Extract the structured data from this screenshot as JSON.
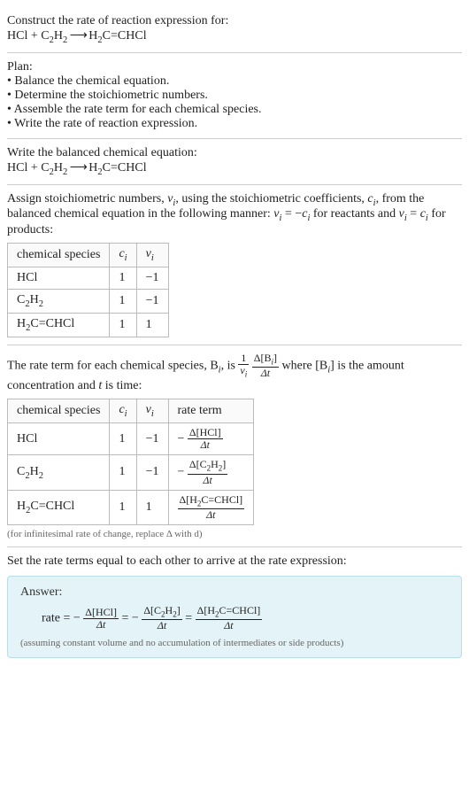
{
  "prompt": {
    "title": "Construct the rate of reaction expression for:",
    "equation_plain": "HCl + C2H2 ⟶ H2C=CHCl",
    "lhs1": "HCl",
    "plus": " + ",
    "lhs2_a": "C",
    "lhs2_b": "2",
    "lhs2_c": "H",
    "lhs2_d": "2",
    "arrow": " ⟶ ",
    "rhs_a": "H",
    "rhs_b": "2",
    "rhs_c": "C=CHCl"
  },
  "plan": {
    "heading": "Plan:",
    "b1": "• Balance the chemical equation.",
    "b2": "• Determine the stoichiometric numbers.",
    "b3": "• Assemble the rate term for each chemical species.",
    "b4": "• Write the rate of reaction expression."
  },
  "balanced": {
    "heading": "Write the balanced chemical equation:"
  },
  "assign": {
    "intro_a": "Assign stoichiometric numbers, ",
    "intro_b": "ν",
    "intro_c": "i",
    "intro_d": ", using the stoichiometric coefficients, ",
    "intro_e": "c",
    "intro_f": "i",
    "intro_g": ", from the balanced chemical equation in the following manner: ",
    "rel1a": "ν",
    "rel1b": "i",
    "rel1c": " = −",
    "rel1d": "c",
    "rel1e": "i",
    "intro_h": " for reactants and ",
    "rel2a": "ν",
    "rel2b": "i",
    "rel2c": " = ",
    "rel2d": "c",
    "rel2e": "i",
    "intro_i": " for products:",
    "col1": "chemical species",
    "col2a": "c",
    "col2b": "i",
    "col3a": "ν",
    "col3b": "i",
    "r1c1": "HCl",
    "r1c2": "1",
    "r1c3": "−1",
    "r2c2": "1",
    "r2c3": "−1",
    "r3c2": "1",
    "r3c3": "1"
  },
  "rate_term": {
    "intro_a": "The rate term for each chemical species, B",
    "intro_b": "i",
    "intro_c": ", is ",
    "one": "1",
    "nu": "ν",
    "nui": "i",
    "dB_l": "Δ[B",
    "dB_i": "i",
    "dB_r": "]",
    "dt": "Δt",
    "intro_d": " where [B",
    "intro_e": "i",
    "intro_f": "] is the amount concentration and ",
    "t": "t",
    "intro_g": " is time:",
    "col1": "chemical species",
    "col2a": "c",
    "col2b": "i",
    "col3a": "ν",
    "col3b": "i",
    "col4": "rate term",
    "r1c1": "HCl",
    "r1c2": "1",
    "r1c3": "−1",
    "r1_num": "Δ[HCl]",
    "r1_den": "Δt",
    "r1_sign": "− ",
    "r2c2": "1",
    "r2c3": "−1",
    "r2_num_a": "Δ[C",
    "r2_num_b": "2",
    "r2_num_c": "H",
    "r2_num_d": "2",
    "r2_num_e": "]",
    "r2_den": "Δt",
    "r2_sign": "− ",
    "r3c2": "1",
    "r3c3": "1",
    "r3_num_a": "Δ[H",
    "r3_num_b": "2",
    "r3_num_c": "C=CHCl]",
    "r3_den": "Δt",
    "note": "(for infinitesimal rate of change, replace Δ with d)"
  },
  "final": {
    "heading": "Set the rate terms equal to each other to arrive at the rate expression:",
    "answer_label": "Answer:",
    "rate": "rate = ",
    "minus": "− ",
    "f1_num": "Δ[HCl]",
    "f1_den": "Δt",
    "eq": " = ",
    "f2_num_a": "Δ[C",
    "f2_num_b": "2",
    "f2_num_c": "H",
    "f2_num_d": "2",
    "f2_num_e": "]",
    "f2_den": "Δt",
    "f3_num_a": "Δ[H",
    "f3_num_b": "2",
    "f3_num_c": "C=CHCl]",
    "f3_den": "Δt",
    "assumption": "(assuming constant volume and no accumulation of intermediates or side products)"
  },
  "chart_data": {
    "type": "table",
    "tables": [
      {
        "title": "Stoichiometric numbers",
        "columns": [
          "chemical species",
          "c_i",
          "ν_i"
        ],
        "rows": [
          [
            "HCl",
            1,
            -1
          ],
          [
            "C2H2",
            1,
            -1
          ],
          [
            "H2C=CHCl",
            1,
            1
          ]
        ]
      },
      {
        "title": "Rate terms",
        "columns": [
          "chemical species",
          "c_i",
          "ν_i",
          "rate term"
        ],
        "rows": [
          [
            "HCl",
            1,
            -1,
            "−Δ[HCl]/Δt"
          ],
          [
            "C2H2",
            1,
            -1,
            "−Δ[C2H2]/Δt"
          ],
          [
            "H2C=CHCl",
            1,
            1,
            "Δ[H2C=CHCl]/Δt"
          ]
        ]
      }
    ],
    "final_expression": "rate = −Δ[HCl]/Δt = −Δ[C2H2]/Δt = Δ[H2C=CHCl]/Δt"
  }
}
